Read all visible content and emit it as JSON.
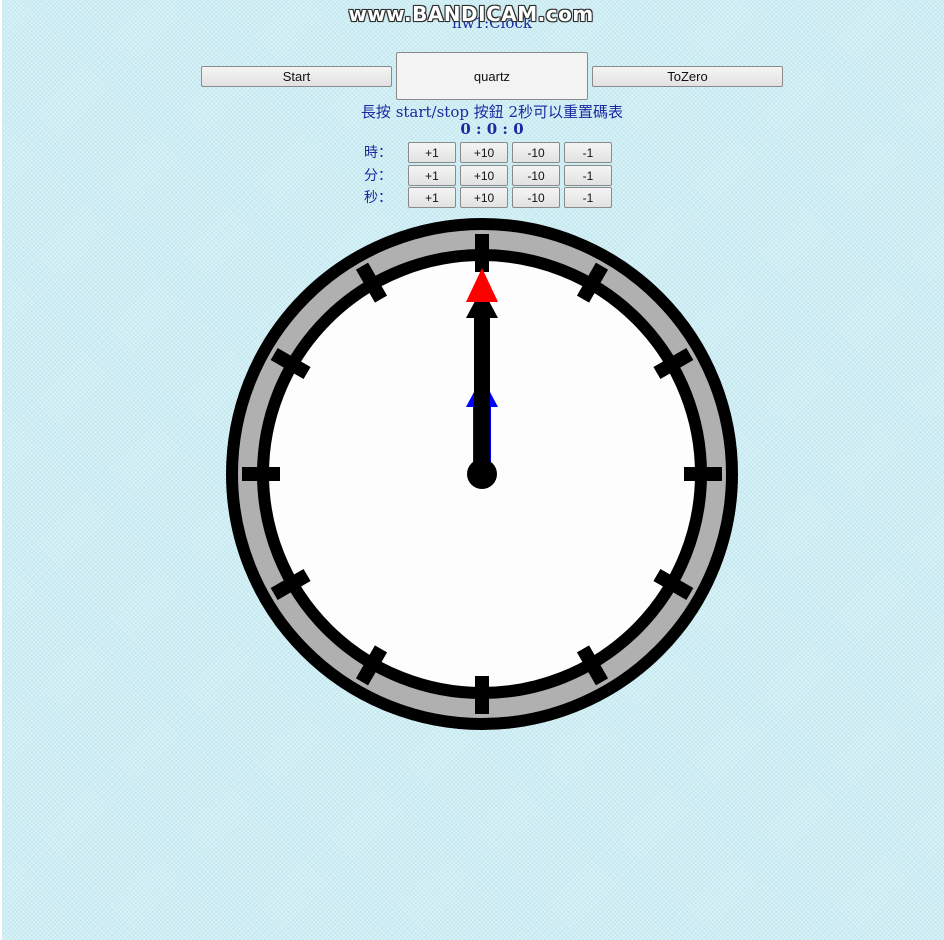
{
  "watermark": "www.BANDICAM.com",
  "page_title": "hw1:Clock",
  "controls": {
    "start_label": "Start",
    "quartz_label": "quartz",
    "tozero_label": "ToZero"
  },
  "hint": "長按 start/stop 按鈕 2秒可以重置碼表",
  "readout": "0 : 0 : 0",
  "adjust_rows": [
    {
      "label": "時：",
      "buttons": [
        "+1",
        "+10",
        "-10",
        "-1"
      ]
    },
    {
      "label": "分：",
      "buttons": [
        "+1",
        "+10",
        "-10",
        "-1"
      ]
    },
    {
      "label": "秒：",
      "buttons": [
        "+1",
        "+10",
        "-10",
        "-1"
      ]
    }
  ],
  "clock": {
    "hours": 0,
    "minutes": 0,
    "seconds": 0,
    "hand_colors": {
      "hour": "#0000ff",
      "minute": "#000000",
      "second": "#ff0000"
    },
    "face_color": "#fdfdfd",
    "rim_color": "#b0b0b0"
  }
}
